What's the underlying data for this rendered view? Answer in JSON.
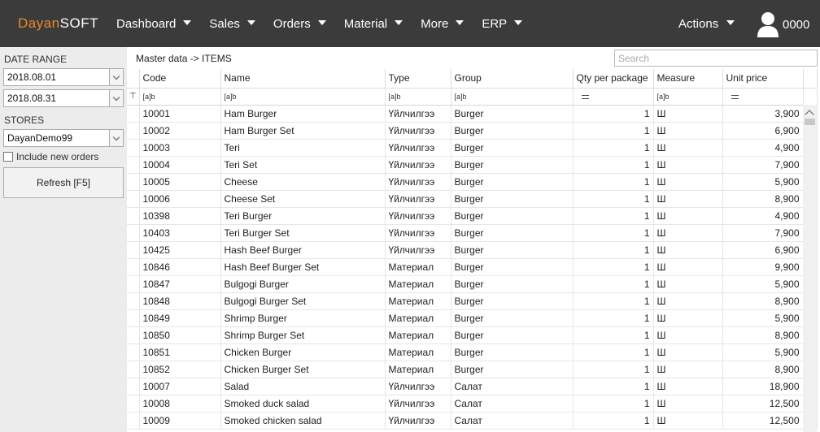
{
  "app": {
    "logo_part1": "Dayan",
    "logo_part2": "SOFT"
  },
  "menu": [
    {
      "label": "Dashboard"
    },
    {
      "label": "Sales"
    },
    {
      "label": "Orders"
    },
    {
      "label": "Material"
    },
    {
      "label": "More"
    },
    {
      "label": "ERP"
    }
  ],
  "actions_label": "Actions",
  "user": {
    "name": "0000",
    "icon": "user-icon"
  },
  "sidebar": {
    "date_range_label": "DATE RANGE",
    "date_from": "2018.08.01",
    "date_to": "2018.08.31",
    "stores_label": "STORES",
    "store": "DayanDemo99",
    "include_new_orders": "Include new orders",
    "refresh_label": "Refresh [F5]"
  },
  "breadcrumb": "Master data -> ITEMS",
  "search": {
    "placeholder": "Search",
    "value": ""
  },
  "grid": {
    "columns": [
      "Code",
      "Name",
      "Type",
      "Group",
      "Qty per package",
      "Measure",
      "Unit price"
    ],
    "filters": [
      "[a]b",
      "[a]b",
      "[a]b",
      "[a]b",
      "=",
      "[a]b",
      "="
    ],
    "rows": [
      [
        "10001",
        "Ham Burger",
        "Үйлчилгээ",
        "Burger",
        "1",
        "Ш",
        "3,900"
      ],
      [
        "10002",
        "Ham Burger Set",
        "Үйлчилгээ",
        "Burger",
        "1",
        "Ш",
        "6,900"
      ],
      [
        "10003",
        "Teri",
        "Үйлчилгээ",
        "Burger",
        "1",
        "Ш",
        "4,900"
      ],
      [
        "10004",
        "Teri Set",
        "Үйлчилгээ",
        "Burger",
        "1",
        "Ш",
        "7,900"
      ],
      [
        "10005",
        "Cheese",
        "Үйлчилгээ",
        "Burger",
        "1",
        "Ш",
        "5,900"
      ],
      [
        "10006",
        "Cheese Set",
        "Үйлчилгээ",
        "Burger",
        "1",
        "Ш",
        "8,900"
      ],
      [
        "10398",
        "Teri Burger",
        "Үйлчилгээ",
        "Burger",
        "1",
        "Ш",
        "4,900"
      ],
      [
        "10403",
        "Teri Burger Set",
        "Үйлчилгээ",
        "Burger",
        "1",
        "Ш",
        "7,900"
      ],
      [
        "10425",
        "Hash Beef Burger",
        "Үйлчилгээ",
        "Burger",
        "1",
        "Ш",
        "6,900"
      ],
      [
        "10846",
        "Hash Beef Burger Set",
        "Материал",
        "Burger",
        "1",
        "Ш",
        "9,900"
      ],
      [
        "10847",
        "Bulgogi Burger",
        "Материал",
        "Burger",
        "1",
        "Ш",
        "5,900"
      ],
      [
        "10848",
        "Bulgogi Burger Set",
        "Материал",
        "Burger",
        "1",
        "Ш",
        "8,900"
      ],
      [
        "10849",
        "Shrimp Burger",
        "Материал",
        "Burger",
        "1",
        "Ш",
        "5,900"
      ],
      [
        "10850",
        "Shrimp Burger Set",
        "Материал",
        "Burger",
        "1",
        "Ш",
        "8,900"
      ],
      [
        "10851",
        "Chicken Burger",
        "Материал",
        "Burger",
        "1",
        "Ш",
        "5,900"
      ],
      [
        "10852",
        "Chicken Burger Set",
        "Материал",
        "Burger",
        "1",
        "Ш",
        "8,900"
      ],
      [
        "10007",
        "Salad",
        "Үйлчилгээ",
        "Салат",
        "1",
        "Ш",
        "18,900"
      ],
      [
        "10008",
        "Smoked duck salad",
        "Үйлчилгээ",
        "Салат",
        "1",
        "Ш",
        "12,500"
      ],
      [
        "10009",
        "Smoked chicken salad",
        "Үйлчилгээ",
        "Салат",
        "1",
        "Ш",
        "12,500"
      ]
    ]
  },
  "colors": {
    "topbar": "#3b3b3b",
    "logo_accent": "#e8892b",
    "sidebar": "#ececec"
  }
}
